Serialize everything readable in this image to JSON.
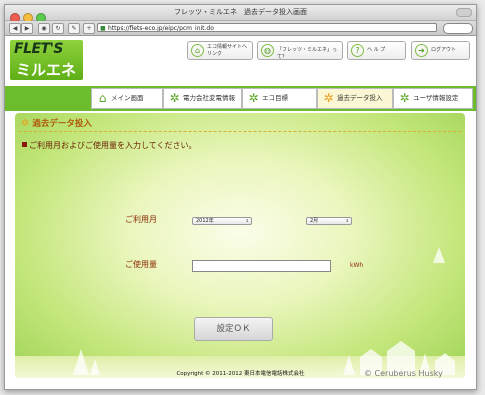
{
  "window": {
    "title": "フレッツ・ミルエネ　過去データ投入画面",
    "url": "https://flets-eco.jp/eipc/pcm_init.do"
  },
  "colors": {
    "brand_green": "#6cbd2d",
    "accent_orange": "#e8a01e",
    "heading_brown": "#b05a0a"
  },
  "logo": {
    "top": "FLET'S",
    "bottom": "ミルエネ"
  },
  "header_links": [
    {
      "icon": "home-icon",
      "label": "エコ情報サイトへリンク"
    },
    {
      "icon": "globe-icon",
      "label": "「フレッツ・ミルエネ」って？"
    },
    {
      "icon": "help-icon",
      "label": "ヘ ル プ"
    },
    {
      "icon": "logout-icon",
      "label": "ログアウト"
    }
  ],
  "nav": {
    "tabs": [
      {
        "label": "メイン画面",
        "icon": "home-icon"
      },
      {
        "label": "電力会社変電情報",
        "icon": "gear-icon"
      },
      {
        "label": "エコ目標",
        "icon": "gear-icon"
      },
      {
        "label": "過去データ投入",
        "icon": "gear-icon"
      },
      {
        "label": "ユーザ情報設定",
        "icon": "gear-icon"
      }
    ],
    "active_index": 3
  },
  "form": {
    "section_title": "過去データ投入",
    "instruction": "ご利用月およびご使用量を入力してください。",
    "month_label": "ご利用月",
    "year_value": "2012年",
    "month_value": "2月",
    "usage_label": "ご使用量",
    "usage_value": "",
    "usage_unit": "kWh",
    "submit_label": "設定ＯＫ"
  },
  "footer": {
    "copyright": "Copyright © 2011-2012 東日本電信電話株式会社"
  },
  "watermark": "© Ceruberus Husky"
}
